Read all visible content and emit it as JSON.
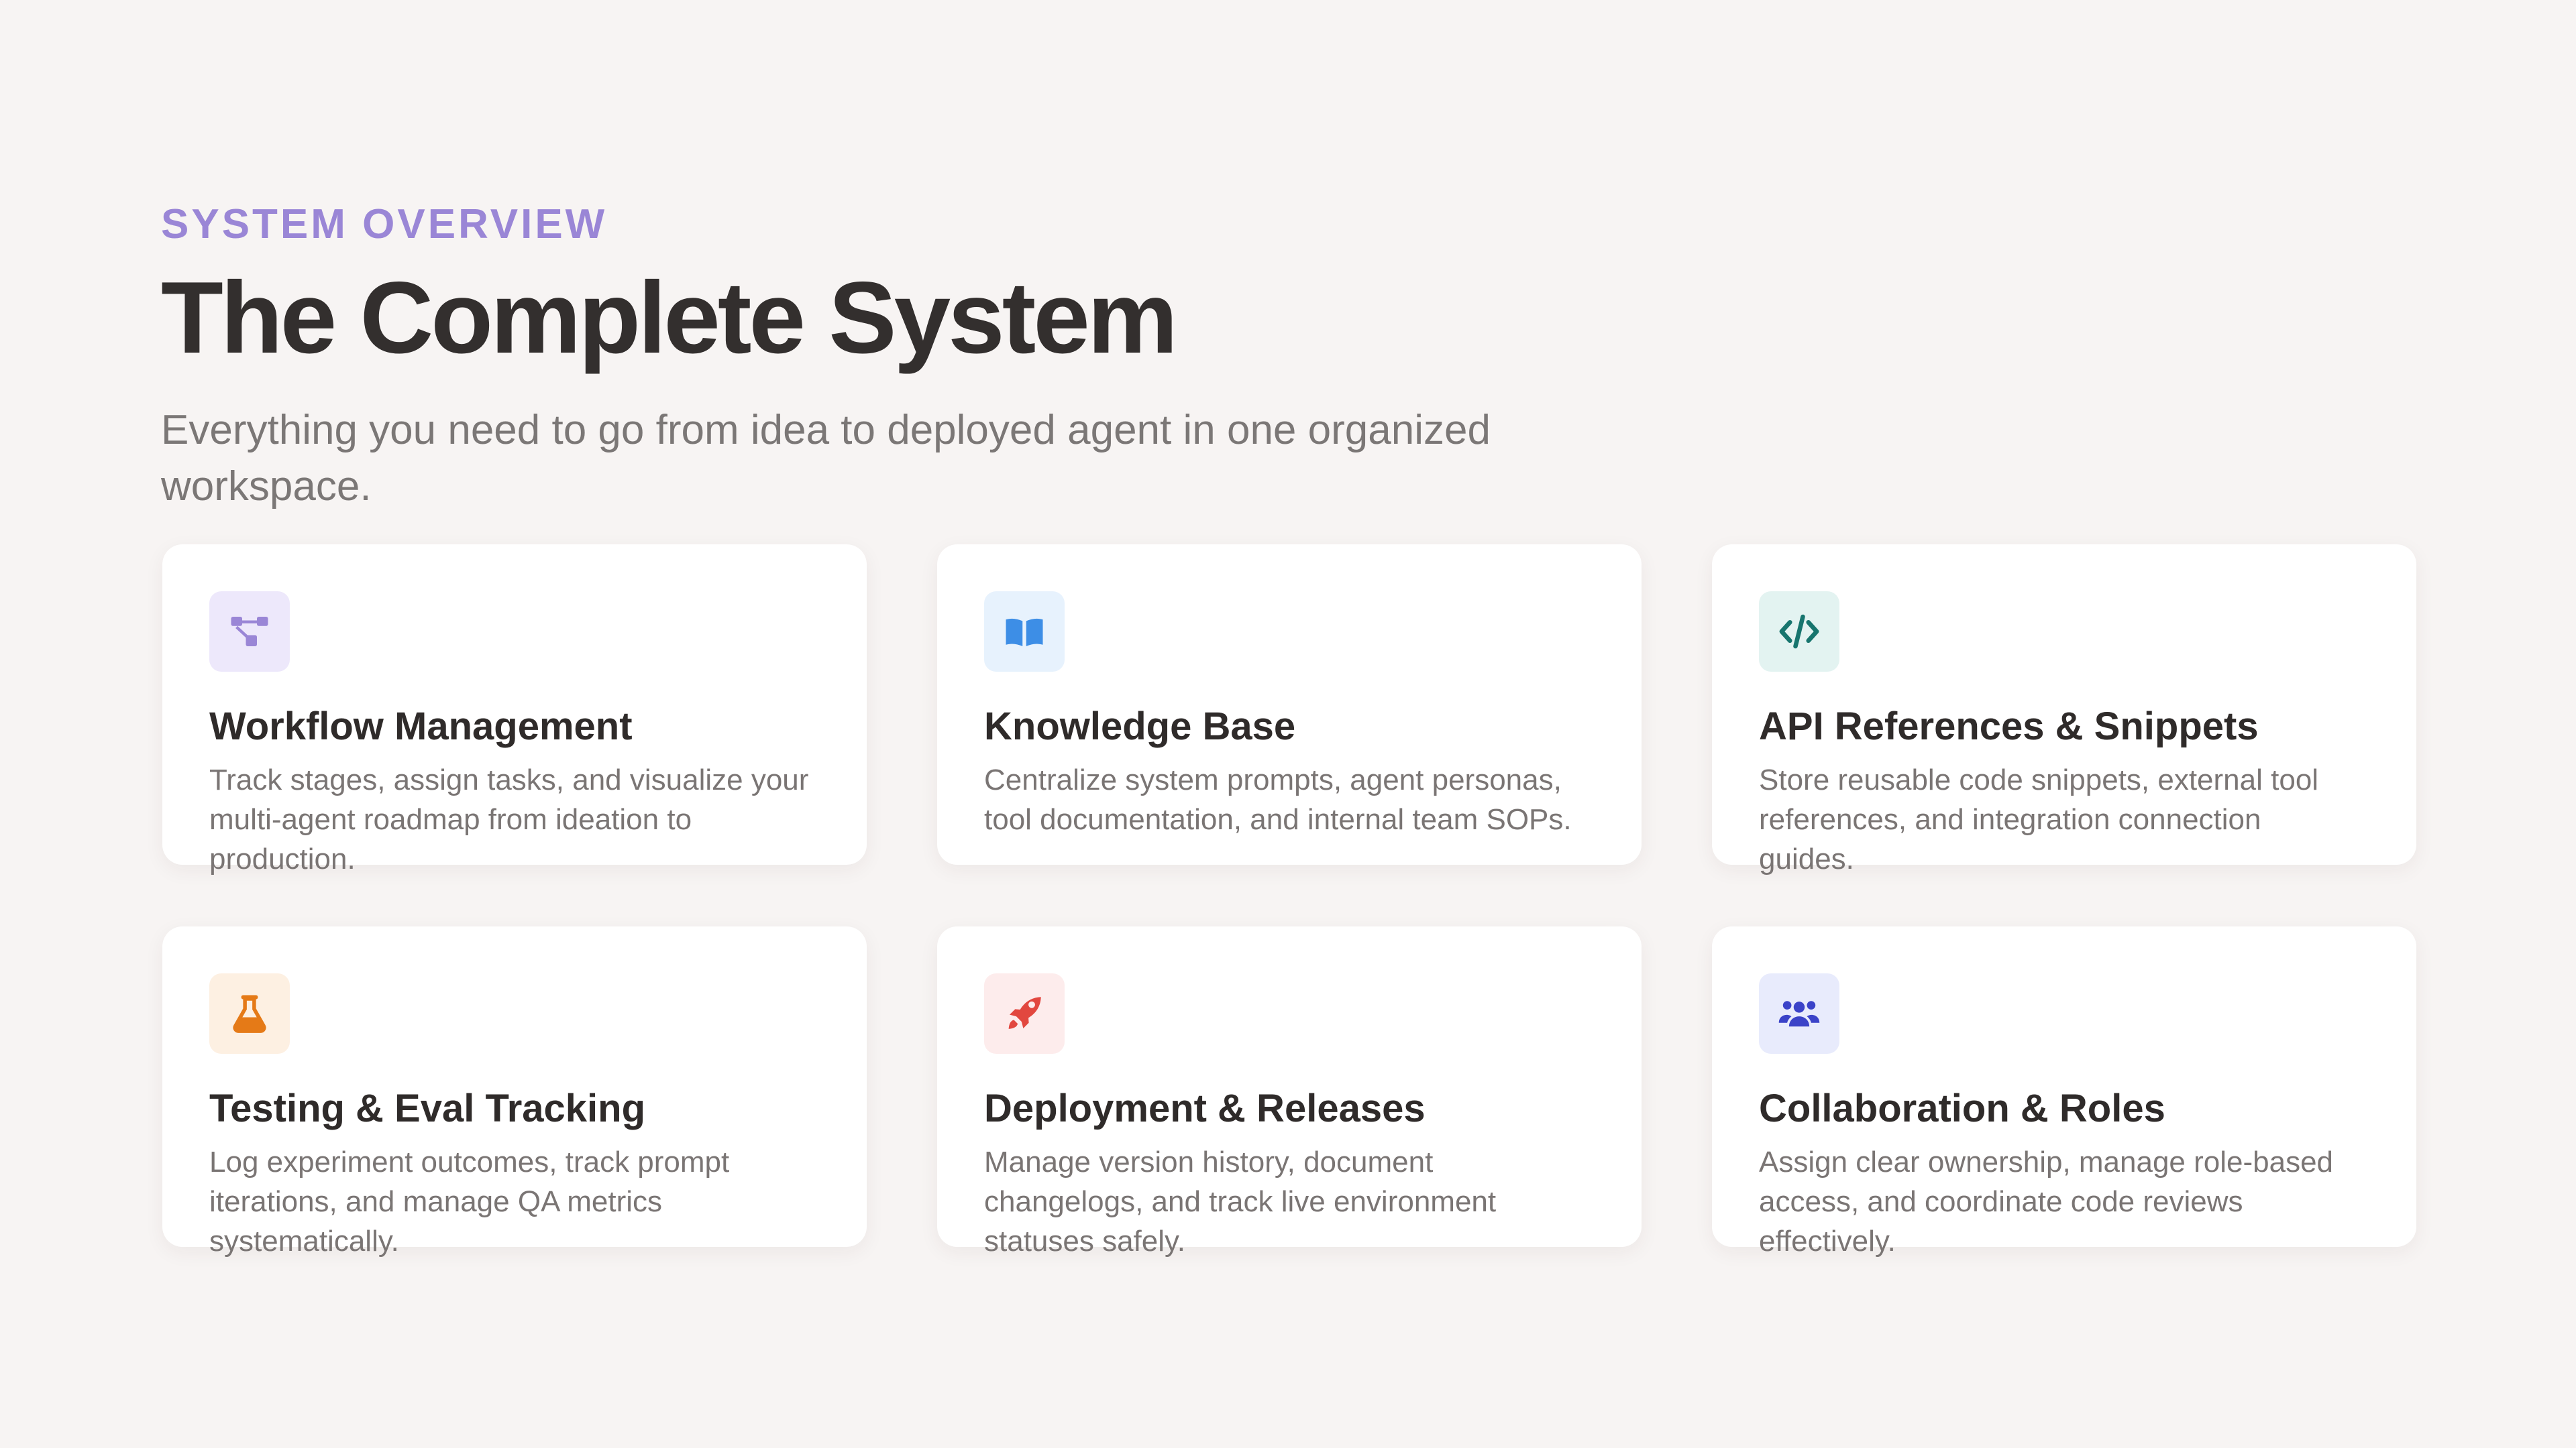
{
  "header": {
    "eyebrow": "SYSTEM OVERVIEW",
    "title": "The Complete System",
    "subtitle": "Everything you need to go from idea to deployed agent in one organized workspace."
  },
  "cards": [
    {
      "icon": "workflow-icon",
      "title": "Workflow Management",
      "description": "Track stages, assign tasks, and visualize your multi-agent roadmap from ideation to production.",
      "icon_bg": "#ede8fb",
      "icon_color": "#9a86d6"
    },
    {
      "icon": "book-icon",
      "title": "Knowledge Base",
      "description": "Centralize system prompts, agent personas, tool documentation, and internal team SOPs.",
      "icon_bg": "#e7f2fd",
      "icon_color": "#3d8ee6"
    },
    {
      "icon": "code-icon",
      "title": "API References & Snippets",
      "description": "Store reusable code snippets, external tool references, and integration connection guides.",
      "icon_bg": "#e3f3f1",
      "icon_color": "#17756e"
    },
    {
      "icon": "flask-icon",
      "title": "Testing & Eval Tracking",
      "description": "Log experiment outcomes, track prompt iterations, and manage QA metrics systematically.",
      "icon_bg": "#fdf0e2",
      "icon_color": "#e57a17"
    },
    {
      "icon": "rocket-icon",
      "title": "Deployment & Releases",
      "description": "Manage version history, document changelogs, and track live environment statuses safely.",
      "icon_bg": "#fdecec",
      "icon_color": "#e2473f"
    },
    {
      "icon": "users-icon",
      "title": "Collaboration & Roles",
      "description": "Assign clear ownership, manage role-based access, and coordinate code reviews effectively.",
      "icon_bg": "#e8ebfc",
      "icon_color": "#3b43c8"
    }
  ]
}
